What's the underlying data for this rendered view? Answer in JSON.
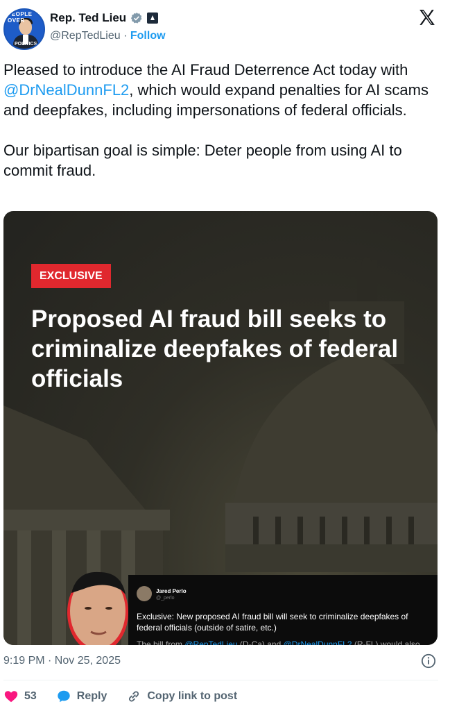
{
  "author": {
    "name": "Rep. Ted Lieu",
    "handle": "@RepTedLieu",
    "separator": "·",
    "follow_label": "Follow",
    "avatar_text_top": "PEOPLE OVER",
    "avatar_text_bottom": "POLITICS"
  },
  "tweet": {
    "line1_before": "Pleased to introduce the AI Fraud Deterrence Act today with ",
    "mention": "@DrNealDunnFL2",
    "line1_after": ", which would expand penalties for AI scams and deepfakes, including impersonations of federal officials.",
    "paragraph2": "Our bipartisan goal is simple: Deter people from using AI to commit fraud."
  },
  "media": {
    "badge": "EXCLUSIVE",
    "headline": "Proposed AI fraud bill seeks to criminalize deepfakes of federal officials",
    "quote": {
      "name": "Jared Perlo",
      "handle": "@_perlo",
      "text": "Exclusive: New proposed AI fraud bill will seek to criminalize deepfakes of federal officials (outside of satire, etc.)",
      "text2_before": "The bill from ",
      "text2_link1": "@RepTedLieu",
      "text2_mid": " (D-Ca) and ",
      "text2_link2": "@DrNealDunnFL2",
      "text2_after": " (R-FL) would also..."
    }
  },
  "meta": {
    "timestamp": "9:19 PM · Nov 25, 2025"
  },
  "actions": {
    "likes": "53",
    "reply_label": "Reply",
    "copy_label": "Copy link to post"
  },
  "colors": {
    "accent": "#1d9bf0",
    "like": "#f91880",
    "exclusive_red": "#e0282e"
  }
}
